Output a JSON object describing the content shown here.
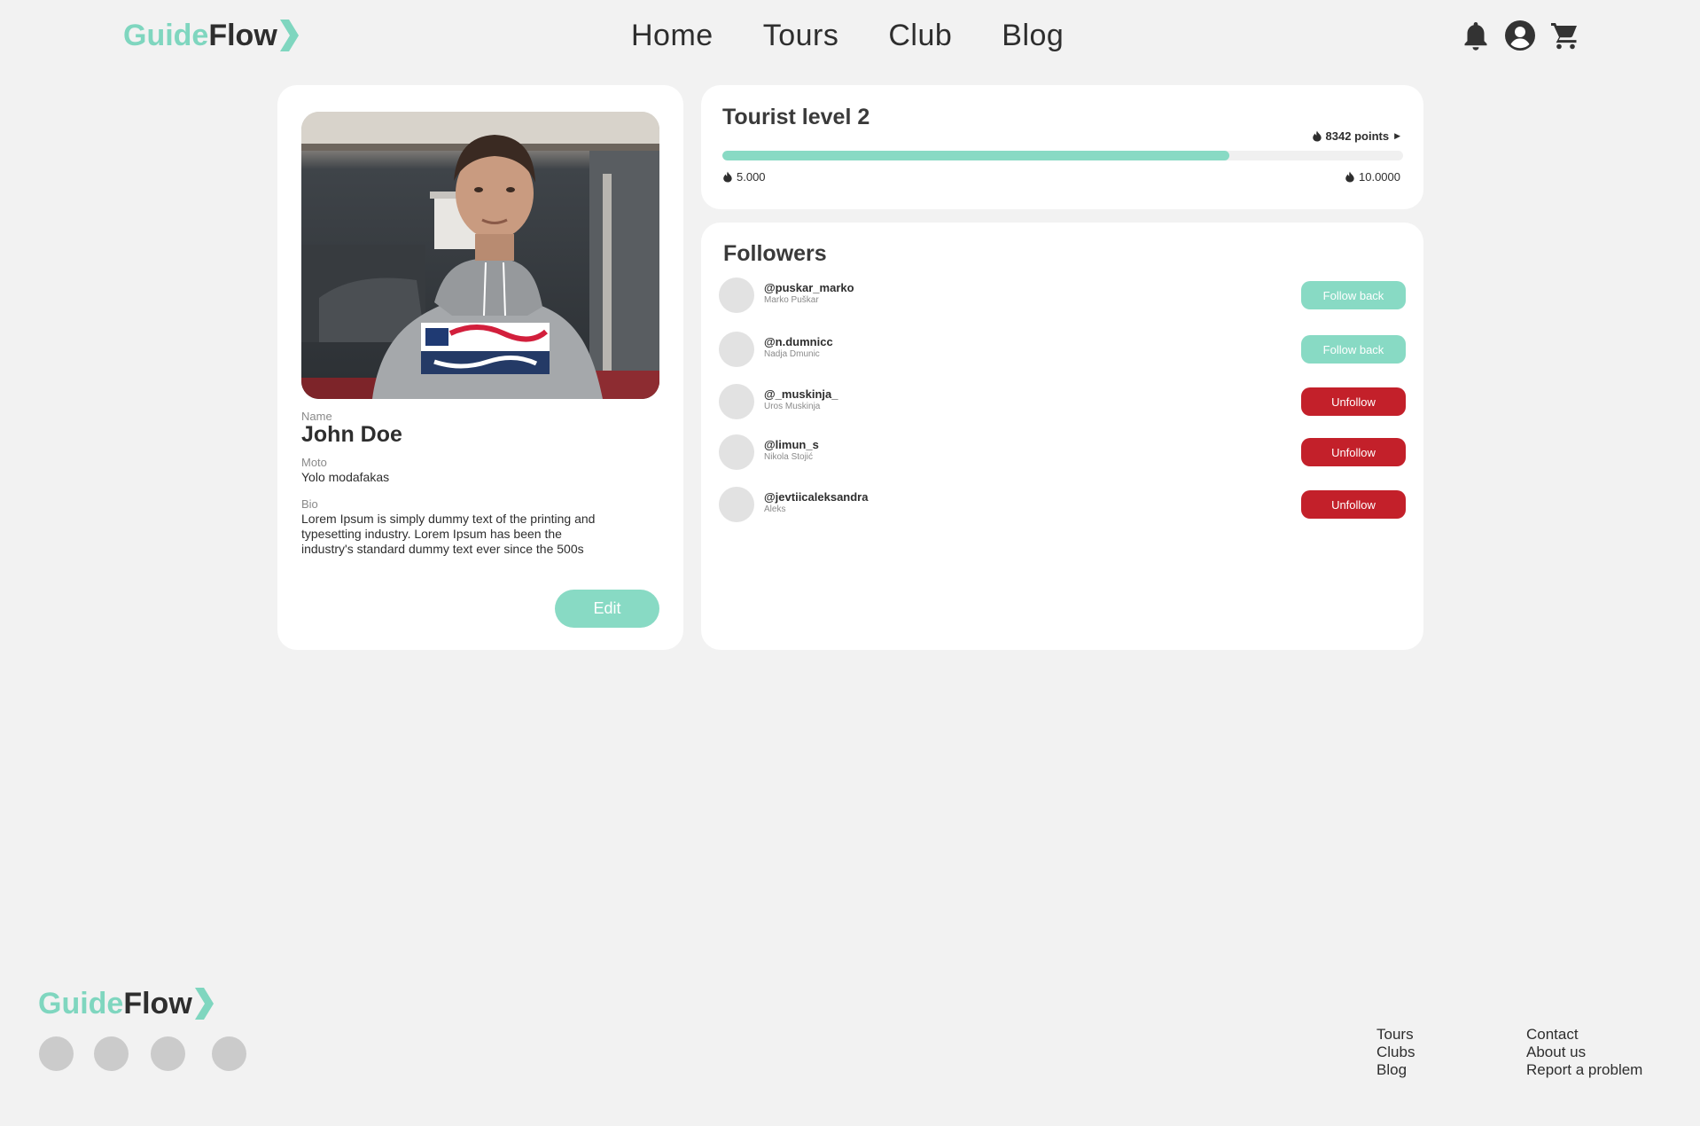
{
  "brand": {
    "part1": "Guide",
    "part2": "Flow",
    "accent_color": "#7fd6bf",
    "dark_color": "#2e2e2e"
  },
  "nav": {
    "items": [
      {
        "label": "Home"
      },
      {
        "label": "Tours"
      },
      {
        "label": "Club"
      },
      {
        "label": "Blog"
      }
    ]
  },
  "header_icons": [
    "bell-icon",
    "account-circle-icon",
    "cart-icon"
  ],
  "profile": {
    "name_label": "Name",
    "name": "John Doe",
    "moto_label": "Moto",
    "moto": "Yolo modafakas",
    "bio_label": "Bio",
    "bio": "Lorem Ipsum is simply dummy text of the printing and typesetting industry. Lorem Ipsum has been the industry's standard dummy text ever since the 500s",
    "edit_label": "Edit"
  },
  "level": {
    "title": "Tourist level 2",
    "points": "8342 points",
    "min_label": "5.000",
    "max_label": "10.0000",
    "progress_fraction": 0.745,
    "progress_color": "#88dac4"
  },
  "followers": {
    "title": "Followers",
    "list": [
      {
        "handle": "@puskar_marko",
        "name": "Marko Puškar",
        "action": "Follow back"
      },
      {
        "handle": "@n.dumnicc",
        "name": "Nadja Dmunic",
        "action": "Follow back"
      },
      {
        "handle": "@_muskinja_",
        "name": "Uros Muskinja",
        "action": "Unfollow"
      },
      {
        "handle": "@limun_s",
        "name": "Nikola Stojić",
        "action": "Unfollow"
      },
      {
        "handle": "@jevtiicaleksandra",
        "name": "Aleks",
        "action": "Unfollow"
      }
    ],
    "follow_back_color": "#88dac4",
    "unfollow_color": "#c3202a"
  },
  "footer": {
    "col1": [
      {
        "label": "Tours"
      },
      {
        "label": "Clubs"
      },
      {
        "label": "Blog"
      }
    ],
    "col2": [
      {
        "label": "Contact"
      },
      {
        "label": "About us"
      },
      {
        "label": "Report a problem"
      }
    ],
    "social_count": 4
  }
}
